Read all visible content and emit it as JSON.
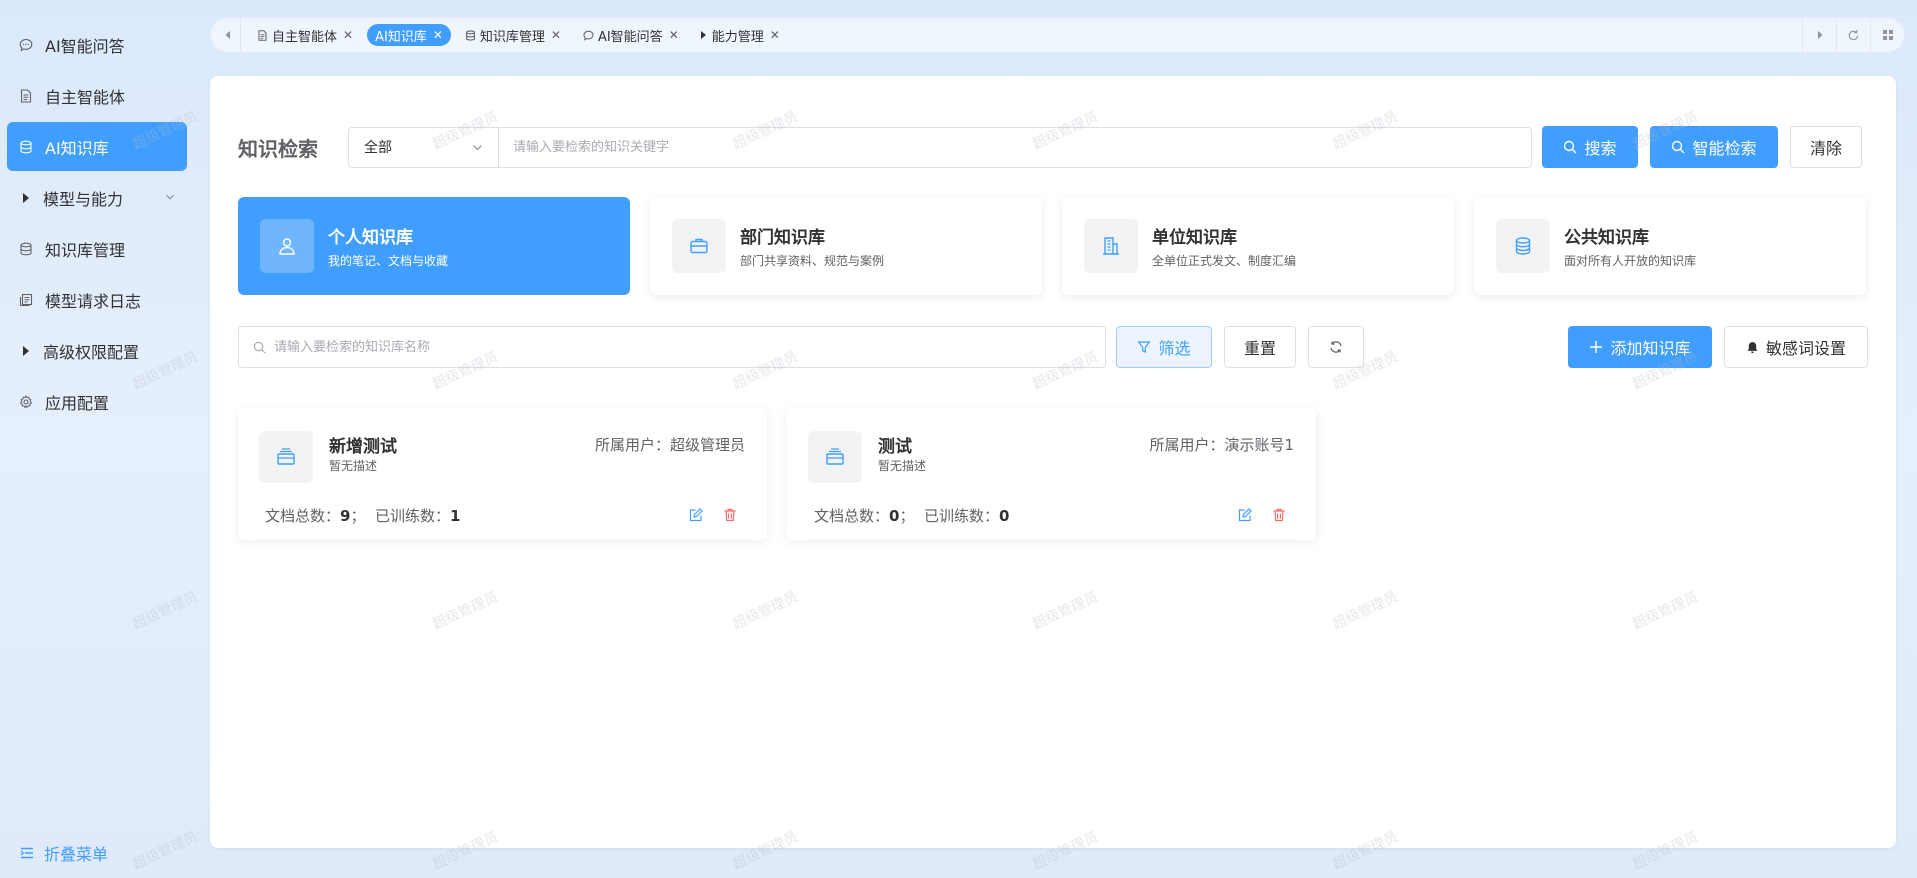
{
  "sidebar": {
    "items": [
      {
        "label": "AI智能问答",
        "icon": "chat-icon"
      },
      {
        "label": "自主智能体",
        "icon": "document-icon"
      },
      {
        "label": "AI知识库",
        "icon": "database-icon",
        "active": true
      },
      {
        "label": "模型与能力",
        "icon": "caret-right-icon",
        "expandable": true
      },
      {
        "label": "知识库管理",
        "icon": "database-icon"
      },
      {
        "label": "模型请求日志",
        "icon": "log-icon"
      },
      {
        "label": "高级权限配置",
        "icon": "caret-right-icon"
      },
      {
        "label": "应用配置",
        "icon": "gear-icon"
      }
    ],
    "collapse_label": "折叠菜单"
  },
  "tabs": [
    {
      "label": "自主智能体",
      "icon": "document-icon"
    },
    {
      "label": "AI知识库",
      "active": true
    },
    {
      "label": "知识库管理",
      "icon": "database-icon"
    },
    {
      "label": "AI智能问答",
      "icon": "chat-icon"
    },
    {
      "label": "能力管理",
      "icon": "caret-right-icon"
    }
  ],
  "search": {
    "title": "知识检索",
    "scope_value": "全部",
    "placeholder": "请输入要检索的知识关键字",
    "search_label": "搜索",
    "smart_label": "智能检索",
    "clear_label": "清除"
  },
  "categories": [
    {
      "title": "个人知识库",
      "desc": "我的笔记、文档与收藏",
      "icon": "user-icon",
      "active": true
    },
    {
      "title": "部门知识库",
      "desc": "部门共享资料、规范与案例",
      "icon": "briefcase-icon"
    },
    {
      "title": "单位知识库",
      "desc": "全单位正式发文、制度汇编",
      "icon": "building-icon"
    },
    {
      "title": "公共知识库",
      "desc": "面对所有人开放的知识库",
      "icon": "coins-icon"
    }
  ],
  "filter": {
    "placeholder": "请输入要检索的知识库名称",
    "filter_label": "筛选",
    "reset_label": "重置",
    "add_label": "添加知识库",
    "sensitive_label": "敏感词设置"
  },
  "knowledge_bases": [
    {
      "name": "新增测试",
      "desc": "暂无描述",
      "owner_label": "所属用户：",
      "owner": "超级管理员",
      "docs_label": "文档总数：",
      "docs": "9",
      "trained_label": "已训练数：",
      "trained": "1"
    },
    {
      "name": "测试",
      "desc": "暂无描述",
      "owner_label": "所属用户：",
      "owner": "演示账号1",
      "docs_label": "文档总数：",
      "docs": "0",
      "trained_label": "已训练数：",
      "trained": "0"
    }
  ],
  "watermark": "超级管理员",
  "colors": {
    "primary": "#409eff",
    "danger": "#f56c6c"
  }
}
